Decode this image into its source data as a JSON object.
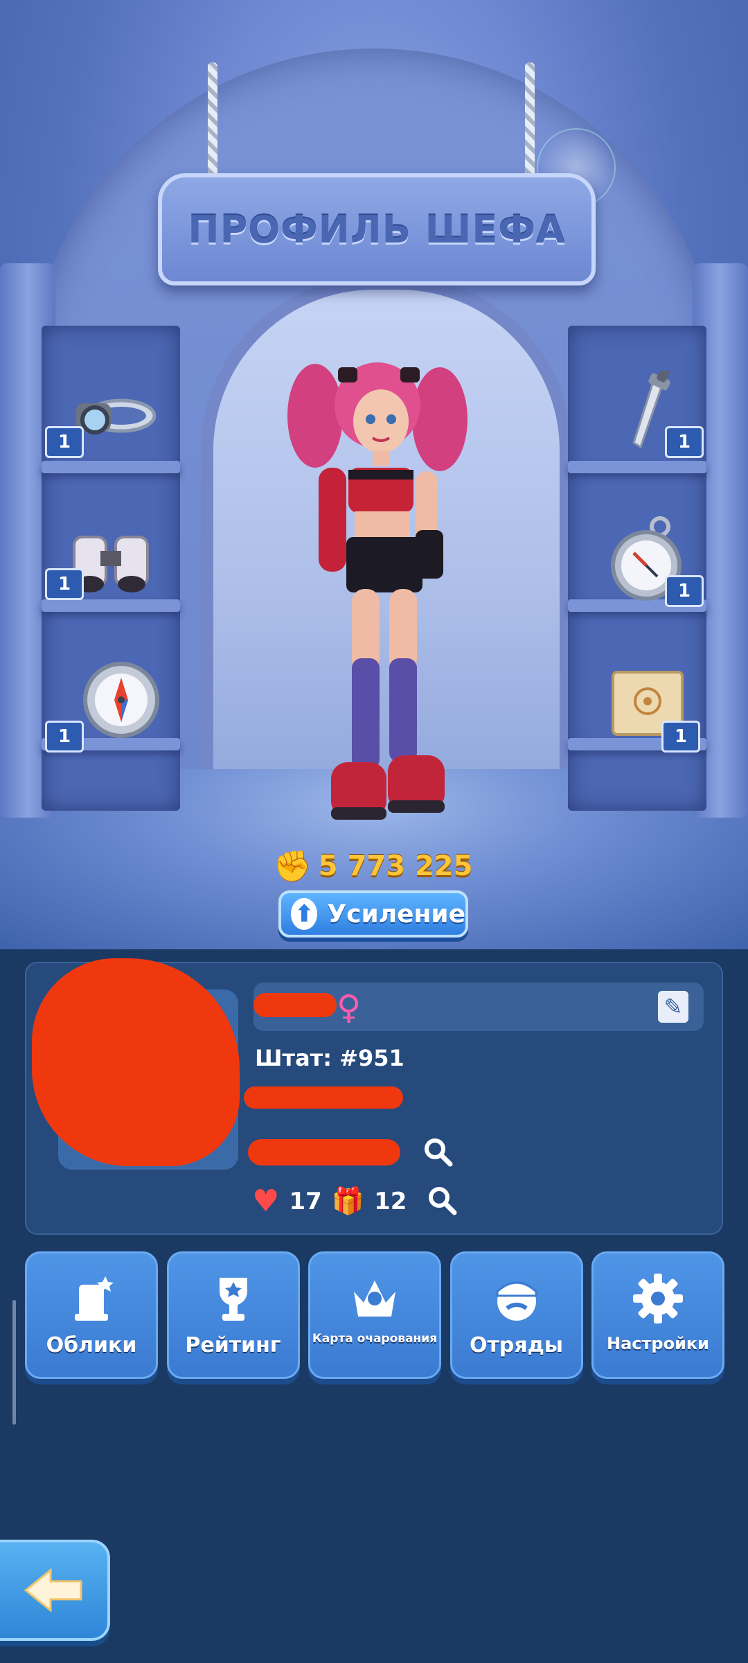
{
  "header": {
    "title": "ПРОФИЛЬ ШЕФА"
  },
  "shelves": {
    "left": [
      {
        "icon": "ring-item-icon",
        "count": "1"
      },
      {
        "icon": "binoculars-icon",
        "count": "1"
      },
      {
        "icon": "compass-icon",
        "count": "1"
      }
    ],
    "right": [
      {
        "icon": "dagger-icon",
        "count": "1"
      },
      {
        "icon": "pocket-watch-icon",
        "count": "1"
      },
      {
        "icon": "map-scroll-icon",
        "count": "1"
      }
    ]
  },
  "power": {
    "value": "5 773 225",
    "icon": "fist-icon"
  },
  "boost": {
    "label": "Усиление"
  },
  "profile": {
    "staff_label": "Штат:",
    "staff_value": "#951",
    "likes": "17",
    "gifts": "12"
  },
  "menu": [
    {
      "label": "Облики",
      "icon": "outfits-icon"
    },
    {
      "label": "Рейтинг",
      "icon": "trophy-icon"
    },
    {
      "label": "Карта очарования",
      "icon": "crown-icon"
    },
    {
      "label": "Отряды",
      "icon": "squad-icon"
    },
    {
      "label": "Настройки",
      "icon": "gear-icon"
    }
  ],
  "colors": {
    "power_gold": "#ffc53a",
    "button_blue": "#3b7bd2",
    "redaction": "#f0380f",
    "gender_pink": "#ff5cae"
  }
}
